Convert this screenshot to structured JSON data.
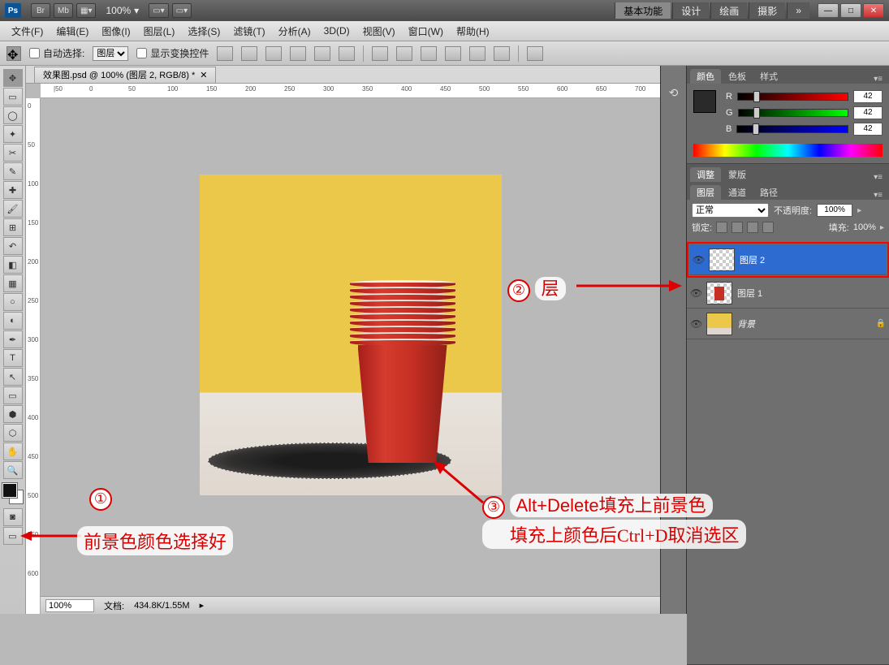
{
  "app": {
    "zoom": "100%"
  },
  "workspace": {
    "active": "基本功能",
    "items": [
      "设计",
      "绘画",
      "摄影"
    ],
    "more": "»"
  },
  "menu": [
    "文件(F)",
    "编辑(E)",
    "图像(I)",
    "图层(L)",
    "选择(S)",
    "滤镜(T)",
    "分析(A)",
    "3D(D)",
    "视图(V)",
    "窗口(W)",
    "帮助(H)"
  ],
  "options": {
    "auto_select": "自动选择:",
    "layer_option": "图层",
    "show_transform": "显示变换控件"
  },
  "doc": {
    "tab": "效果图.psd @ 100% (图层 2, RGB/8) *"
  },
  "rulerH": [
    "|50",
    "0",
    "50",
    "100",
    "150",
    "200",
    "250",
    "300",
    "350",
    "400",
    "450",
    "500",
    "550",
    "600",
    "650",
    "700"
  ],
  "rulerV": [
    "0",
    "50",
    "100",
    "150",
    "200",
    "250",
    "300",
    "350",
    "400",
    "450",
    "500",
    "550",
    "600"
  ],
  "status": {
    "zoom": "100%",
    "doc_label": "文档:",
    "doc_size": "434.8K/1.55M"
  },
  "panels": {
    "color_tabs": [
      "颜色",
      "色板",
      "样式"
    ],
    "adjust_tabs": [
      "调整",
      "蒙版"
    ],
    "layer_tabs": [
      "图层",
      "通道",
      "路径"
    ],
    "rgb": {
      "r_label": "R",
      "g_label": "G",
      "b_label": "B",
      "r": "42",
      "g": "42",
      "b": "42"
    },
    "blend_mode": "正常",
    "opacity_label": "不透明度:",
    "opacity": "100%",
    "lock_label": "锁定:",
    "fill_label": "填充:",
    "fill": "100%",
    "layers": [
      {
        "name": "图层 2",
        "selected": true,
        "thumb": "trans"
      },
      {
        "name": "图层 1",
        "selected": false,
        "thumb": "cup"
      },
      {
        "name": "背景",
        "selected": false,
        "thumb": "bg",
        "locked": true
      }
    ]
  },
  "annotations": {
    "a1_num": "①",
    "a1_text": "前景色颜色选择好",
    "a2_num": "②",
    "a2_text": "层",
    "a3_num": "③",
    "a3_line1": "Alt+Delete填充上前景色",
    "a3_line2": "填充上颜色后Ctrl+D取消选区"
  }
}
